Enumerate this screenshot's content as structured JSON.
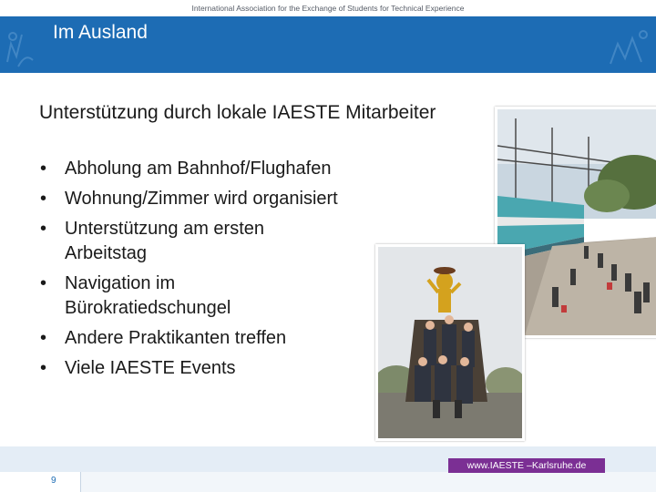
{
  "header": {
    "org_line": "International Association for the Exchange of Students for Technical Experience",
    "title": "Im Ausland",
    "band_color": "#1d6cb4"
  },
  "content": {
    "subtitle": "Unterstützung durch lokale IAESTE Mitarbeiter",
    "bullet_symbol": "•",
    "bullets": [
      "Abholung am Bahnhof/Flughafen",
      "Wohnung/Zimmer wird organisiert",
      "Unterstützung am ersten Arbeitstag",
      "Navigation im Bürokratiedschungel",
      "Andere Praktikanten treffen",
      "Viele IAESTE Events"
    ]
  },
  "footer": {
    "page_number": "9",
    "url": "www.IAESTE –Karlsruhe.de",
    "url_box_color": "#7b2f94"
  }
}
